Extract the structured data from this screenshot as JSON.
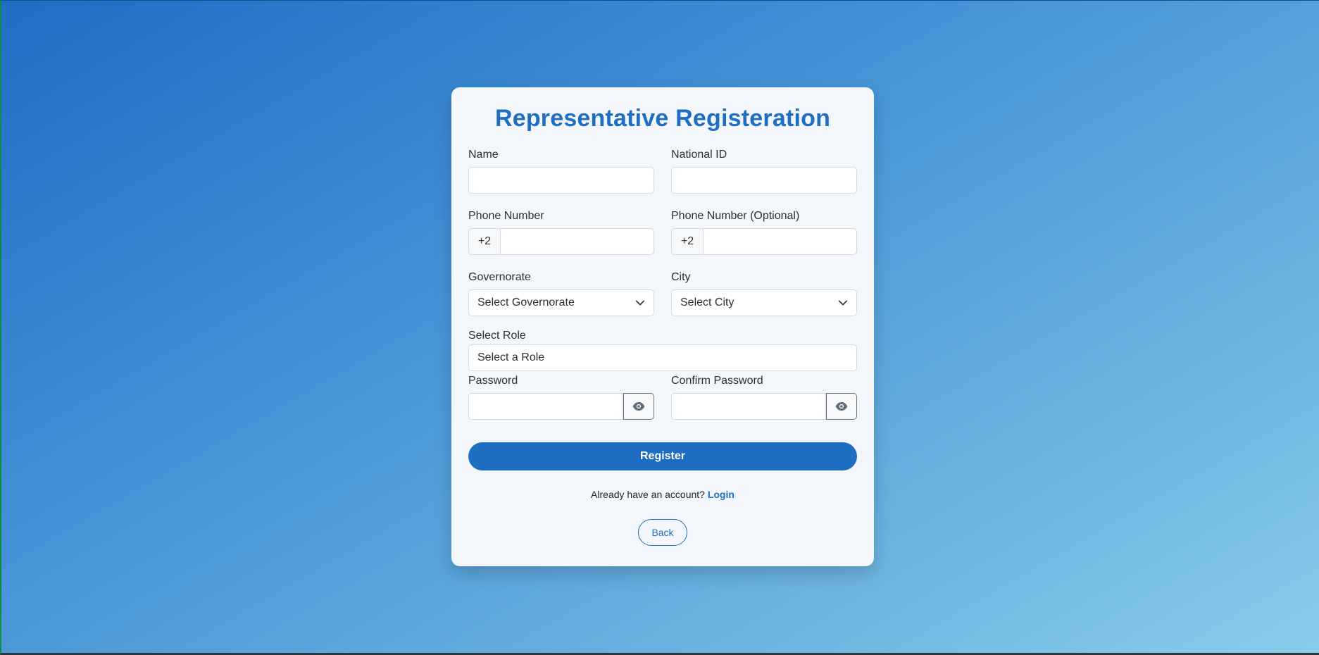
{
  "form": {
    "title": "Representative Registeration",
    "fields": {
      "name": {
        "label": "Name",
        "value": ""
      },
      "national_id": {
        "label": "National ID",
        "value": ""
      },
      "phone": {
        "label": "Phone Number",
        "prefix": "+2",
        "value": ""
      },
      "phone_optional": {
        "label": "Phone Number (Optional)",
        "prefix": "+2",
        "value": ""
      },
      "governorate": {
        "label": "Governorate",
        "selected": "Select Governorate"
      },
      "city": {
        "label": "City",
        "selected": "Select City"
      },
      "role": {
        "label": "Select Role",
        "selected": "Select a Role"
      },
      "password": {
        "label": "Password",
        "value": ""
      },
      "confirm_password": {
        "label": "Confirm Password",
        "value": ""
      }
    },
    "register_label": "Register",
    "login_prompt": "Already have an account?",
    "login_link": "Login",
    "back_label": "Back"
  },
  "colors": {
    "accent": "#1d6ec3",
    "card_bg": "#f3f7fb",
    "gradient_start": "#1f6dc6",
    "gradient_end": "#87cdeb"
  },
  "icons": {
    "password_toggle": "eye-icon",
    "select_arrow": "chevron-down-icon"
  }
}
